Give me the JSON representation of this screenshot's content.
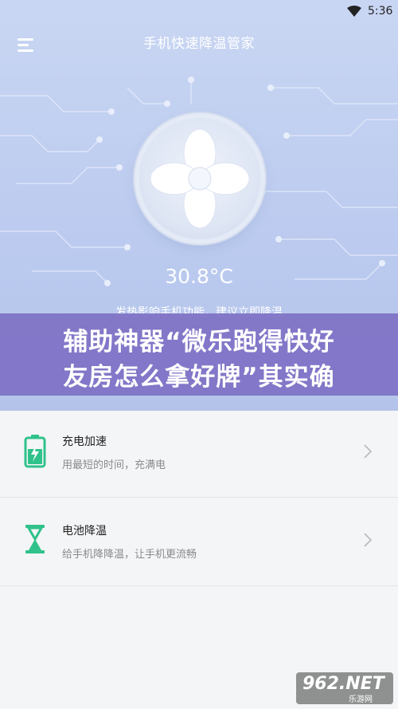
{
  "status_bar": {
    "time": "5:36",
    "wifi_icon": "wifi-icon"
  },
  "header": {
    "title": "手机快速降温管家",
    "menu_icon": "menu-icon"
  },
  "hero": {
    "temperature": "30.8°C",
    "warning": "发热影响手机功能，建议立即降温",
    "fan_icon": "fan-icon"
  },
  "banner": {
    "line1": "辅助神器“微乐跑得快好",
    "line2": "友房怎么拿好牌”其实确"
  },
  "list": [
    {
      "title": "充电加速",
      "subtitle": "用最短的时间，充满电",
      "icon": "battery-charge-icon"
    },
    {
      "title": "电池降温",
      "subtitle": "给手机降降温，让手机更流畅",
      "icon": "hourglass-icon"
    }
  ],
  "watermark": {
    "brand": "962.NET",
    "sub": "乐游网"
  },
  "colors": {
    "accent_green": "#2fc28a",
    "hero_blue": "#bccbef",
    "banner_purple": "#7e70c4"
  }
}
